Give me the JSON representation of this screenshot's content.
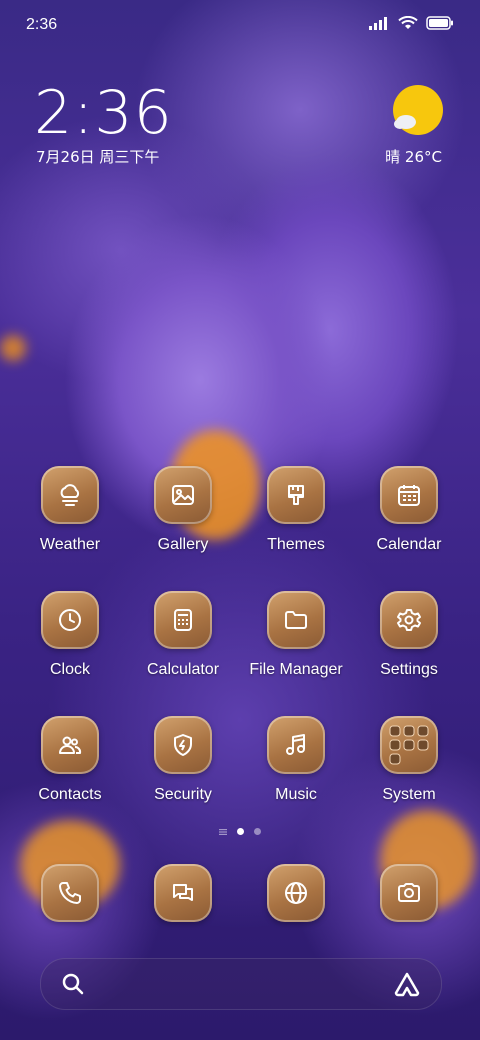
{
  "status_bar": {
    "time": "2:36"
  },
  "clock_widget": {
    "time": "2:36",
    "date": "7月26日 周三下午"
  },
  "weather_widget": {
    "text": "晴 26°C",
    "icon": "sun-cloud-icon",
    "sun_color": "#f7c70d"
  },
  "apps": [
    {
      "label": "Weather",
      "icon": "weather-icon"
    },
    {
      "label": "Gallery",
      "icon": "gallery-icon"
    },
    {
      "label": "Themes",
      "icon": "themes-brush-icon"
    },
    {
      "label": "Calendar",
      "icon": "calendar-icon"
    },
    {
      "label": "Clock",
      "icon": "clock-icon"
    },
    {
      "label": "Calculator",
      "icon": "calculator-icon"
    },
    {
      "label": "File Manager",
      "icon": "folder-icon"
    },
    {
      "label": "Settings",
      "icon": "gear-icon"
    },
    {
      "label": "Contacts",
      "icon": "contacts-icon"
    },
    {
      "label": "Security",
      "icon": "shield-icon"
    },
    {
      "label": "Music",
      "icon": "music-note-icon"
    },
    {
      "label": "System",
      "icon": "folder-grid-icon"
    }
  ],
  "page_indicator": {
    "pages": 2,
    "active": 1
  },
  "dock": [
    {
      "icon": "phone-icon"
    },
    {
      "icon": "messages-icon"
    },
    {
      "icon": "browser-globe-icon"
    },
    {
      "icon": "camera-icon"
    }
  ],
  "search_bar": {
    "left_icon": "search-icon",
    "right_icon": "assistant-icon"
  },
  "accent": {
    "tile_color": "#b47e4c",
    "stamen_color": "#f59a1d"
  }
}
